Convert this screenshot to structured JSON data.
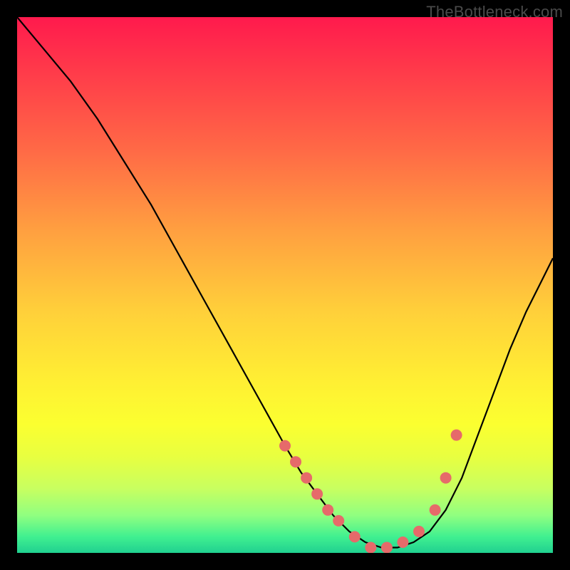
{
  "watermark": "TheBottleneck.com",
  "chart_data": {
    "type": "line",
    "title": "",
    "xlabel": "",
    "ylabel": "",
    "xlim": [
      0,
      100
    ],
    "ylim": [
      0,
      100
    ],
    "series": [
      {
        "name": "bottleneck-curve",
        "x": [
          0,
          5,
          10,
          15,
          20,
          25,
          30,
          35,
          40,
          45,
          50,
          53,
          56,
          59,
          62,
          65,
          68,
          71,
          74,
          77,
          80,
          83,
          86,
          89,
          92,
          95,
          98,
          100
        ],
        "y": [
          100,
          94,
          88,
          81,
          73,
          65,
          56,
          47,
          38,
          29,
          20,
          15,
          11,
          7,
          4,
          2,
          1,
          1,
          2,
          4,
          8,
          14,
          22,
          30,
          38,
          45,
          51,
          55
        ]
      }
    ],
    "markers": {
      "name": "highlight-points",
      "x": [
        50,
        52,
        54,
        56,
        58,
        60,
        63,
        66,
        69,
        72,
        75,
        78,
        80,
        82
      ],
      "y": [
        20,
        17,
        14,
        11,
        8,
        6,
        3,
        1,
        1,
        2,
        4,
        8,
        14,
        22
      ]
    }
  }
}
